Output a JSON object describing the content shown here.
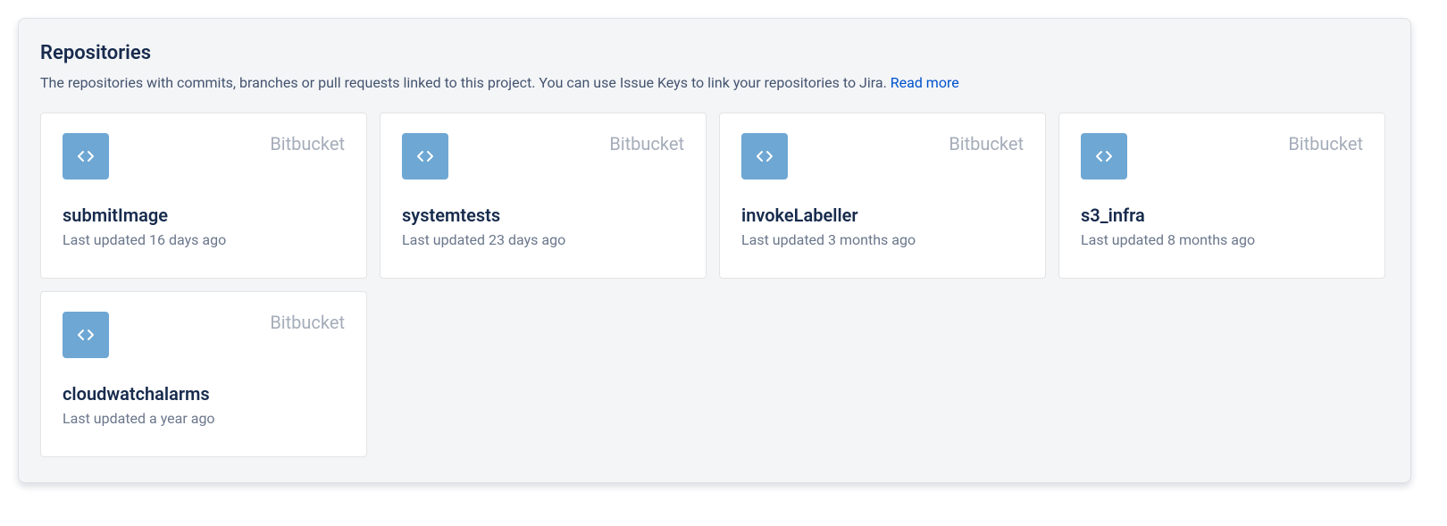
{
  "panel": {
    "title": "Repositories",
    "description_pre": "The repositories with commits, branches or pull requests linked to this project. You can use Issue Keys to link your repositories to Jira. ",
    "read_more": "Read more"
  },
  "repos": [
    {
      "name": "submitImage",
      "provider": "Bitbucket",
      "updated": "Last updated 16 days ago"
    },
    {
      "name": "systemtests",
      "provider": "Bitbucket",
      "updated": "Last updated 23 days ago"
    },
    {
      "name": "invokeLabeller",
      "provider": "Bitbucket",
      "updated": "Last updated 3 months ago"
    },
    {
      "name": "s3_infra",
      "provider": "Bitbucket",
      "updated": "Last updated 8 months ago"
    },
    {
      "name": "cloudwatchalarms",
      "provider": "Bitbucket",
      "updated": "Last updated a year ago"
    }
  ]
}
